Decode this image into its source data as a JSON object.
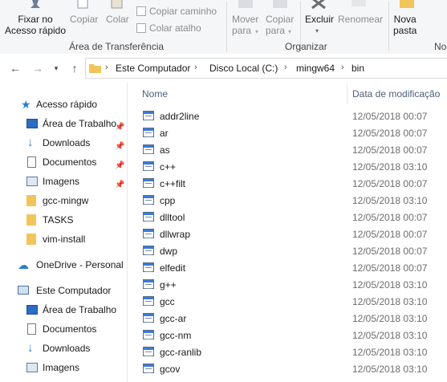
{
  "ribbon": {
    "pin_quick_access": "Fixar no\nAcesso rápido",
    "copy": "Copiar",
    "paste": "Colar",
    "copy_path": "Copiar caminho",
    "paste_shortcut": "Colar atalho",
    "clipboard_group": "Área de Transferência",
    "move_to": "Mover\npara",
    "copy_to": "Copiar\npara",
    "delete": "Excluir",
    "rename": "Renomear",
    "organize_group": "Organizar",
    "new_folder": "Nova\npasta",
    "new_group_partial": "No"
  },
  "breadcrumb": [
    "Este Computador",
    "Disco Local (C:)",
    "mingw64",
    "bin"
  ],
  "nav": {
    "quick_access": "Acesso rápido",
    "desktop": "Área de Trabalho",
    "downloads": "Downloads",
    "documents": "Documentos",
    "pictures": "Imagens",
    "gcc_mingw": "gcc-mingw",
    "tasks": "TASKS",
    "vim_install": "vim-install",
    "onedrive": "OneDrive - Personal",
    "this_pc": "Este Computador",
    "pc_desktop": "Área de Trabalho",
    "pc_documents": "Documentos",
    "pc_downloads": "Downloads",
    "pc_pictures": "Imagens"
  },
  "columns": {
    "name": "Nome",
    "date_modified": "Data de modificação"
  },
  "files": [
    {
      "name": "addr2line",
      "date": "12/05/2018 00:07"
    },
    {
      "name": "ar",
      "date": "12/05/2018 00:07"
    },
    {
      "name": "as",
      "date": "12/05/2018 00:07"
    },
    {
      "name": "c++",
      "date": "12/05/2018 03:10"
    },
    {
      "name": "c++filt",
      "date": "12/05/2018 00:07"
    },
    {
      "name": "cpp",
      "date": "12/05/2018 03:10"
    },
    {
      "name": "dlltool",
      "date": "12/05/2018 00:07"
    },
    {
      "name": "dllwrap",
      "date": "12/05/2018 00:07"
    },
    {
      "name": "dwp",
      "date": "12/05/2018 00:07"
    },
    {
      "name": "elfedit",
      "date": "12/05/2018 00:07"
    },
    {
      "name": "g++",
      "date": "12/05/2018 03:10"
    },
    {
      "name": "gcc",
      "date": "12/05/2018 03:10"
    },
    {
      "name": "gcc-ar",
      "date": "12/05/2018 03:10"
    },
    {
      "name": "gcc-nm",
      "date": "12/05/2018 03:10"
    },
    {
      "name": "gcc-ranlib",
      "date": "12/05/2018 03:10"
    },
    {
      "name": "gcov",
      "date": "12/05/2018 03:10"
    }
  ],
  "colors": {
    "accent": "#3a7bd5",
    "folder": "#f2c55c",
    "header_text": "#4c607a"
  }
}
